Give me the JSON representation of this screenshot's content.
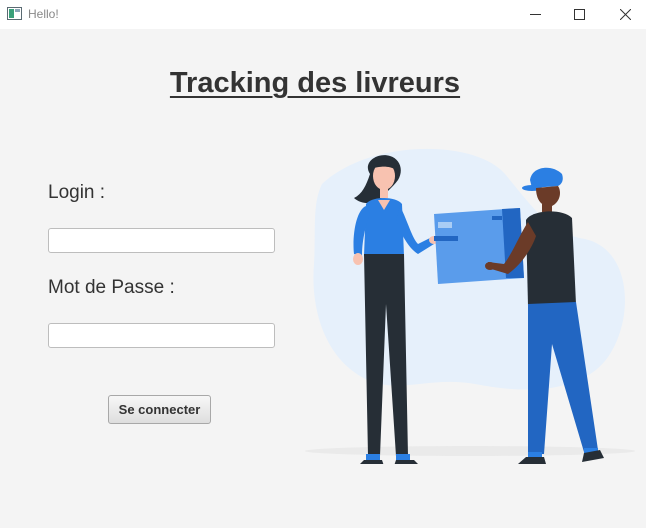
{
  "window": {
    "title": "Hello!",
    "icons": [
      "app-icon",
      "minimize-icon",
      "maximize-icon",
      "close-icon"
    ]
  },
  "page": {
    "title": "Tracking des livreurs"
  },
  "form": {
    "login_label": "Login :",
    "login_value": "",
    "password_label": "Mot de Passe :",
    "password_value": "",
    "submit_label": "Se connecter"
  },
  "colors": {
    "background": "#f4f4f4",
    "accent_blue": "#2b7fe3",
    "dark_navy": "#262e36",
    "blob": "#e6f0fb"
  }
}
